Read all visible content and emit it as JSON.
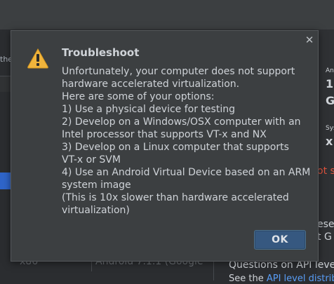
{
  "background": {
    "left_label": "the",
    "table_row": {
      "col1": "x86",
      "col2": "Android 7.1.1 (Google"
    },
    "right": {
      "label_a": "An",
      "value_1": "1",
      "value_g": "G",
      "label_sys": "Sys",
      "value_x": "x",
      "warning": "ot su",
      "text_ese": "ese",
      "text_tg": "t G"
    },
    "questions_text": "Questions on API level?",
    "see_text": "See the ",
    "see_link": "API level distrib"
  },
  "dialog": {
    "title": "Troubleshoot",
    "close_glyph": "✕",
    "message_lines": [
      "Unfortunately, your computer does not support",
      "hardware accelerated virtualization.",
      "Here are some of your options:",
      "1) Use a physical device for testing",
      "2) Develop on a Windows/OSX computer with an",
      "Intel processor that supports VT-x and NX",
      "3) Develop on a Linux computer that supports",
      "VT-x or SVM",
      "4) Use an Android Virtual Device based on an ARM",
      "system image",
      "(This is 10x slower than hardware accelerated",
      "virtualization)"
    ],
    "ok_label": "OK",
    "icon": "warning-icon"
  },
  "colors": {
    "dialog_bg": "#3c3f41",
    "text": "#cfd3d8",
    "ok_bg": "#365880",
    "warning_yellow": "#f0b43c",
    "selection_blue": "#2f65ca",
    "error_red": "#e0533d"
  }
}
